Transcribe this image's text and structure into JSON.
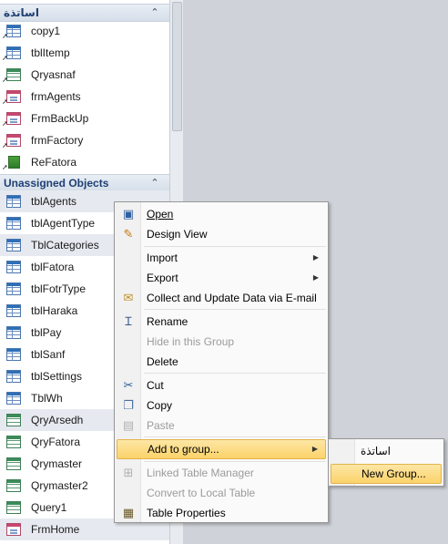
{
  "nav": {
    "groups": [
      {
        "title": "اساتذة",
        "items": [
          {
            "label": "copy1",
            "icon": "table-icon",
            "linked": true
          },
          {
            "label": "tblItemp",
            "icon": "table-icon",
            "linked": true
          },
          {
            "label": "Qryasnaf",
            "icon": "query-icon",
            "linked": true
          },
          {
            "label": "frmAgents",
            "icon": "form-icon",
            "linked": true
          },
          {
            "label": "FrmBackUp",
            "icon": "form-icon",
            "linked": true
          },
          {
            "label": "frmFactory",
            "icon": "form-icon",
            "linked": true
          },
          {
            "label": "ReFatora",
            "icon": "report-icon",
            "linked": true
          }
        ]
      },
      {
        "title": "Unassigned Objects",
        "items": [
          {
            "label": "tblAgents",
            "icon": "table-icon",
            "highlighted": true
          },
          {
            "label": "tblAgentType",
            "icon": "table-icon"
          },
          {
            "label": "TblCategories",
            "icon": "table-icon",
            "highlighted": true
          },
          {
            "label": "tblFatora",
            "icon": "table-icon"
          },
          {
            "label": "tblFotrType",
            "icon": "table-icon"
          },
          {
            "label": "tblHaraka",
            "icon": "table-icon"
          },
          {
            "label": "tblPay",
            "icon": "table-icon"
          },
          {
            "label": "tblSanf",
            "icon": "table-icon"
          },
          {
            "label": "tblSettings",
            "icon": "table-icon"
          },
          {
            "label": "TblWh",
            "icon": "table-icon"
          },
          {
            "label": "QryArsedh",
            "icon": "query-icon",
            "highlighted": true
          },
          {
            "label": "QryFatora",
            "icon": "query-icon"
          },
          {
            "label": "Qrymaster",
            "icon": "query-icon"
          },
          {
            "label": "Qrymaster2",
            "icon": "query-icon"
          },
          {
            "label": "Query1",
            "icon": "query-icon"
          },
          {
            "label": "FrmHome",
            "icon": "form-icon",
            "highlighted": true
          }
        ]
      }
    ]
  },
  "context_menu": {
    "items": [
      {
        "label": "Open",
        "icon": "open-icon"
      },
      {
        "label": "Design View",
        "icon": "design-view-icon"
      },
      {
        "label": "Import",
        "submenu": true
      },
      {
        "label": "Export",
        "submenu": true
      },
      {
        "label": "Collect and Update Data via E-mail",
        "icon": "collect-data-icon"
      },
      {
        "label": "Rename",
        "icon": "rename-icon"
      },
      {
        "label": "Hide in this Group",
        "disabled": true
      },
      {
        "label": "Delete"
      },
      {
        "label": "Cut",
        "icon": "scissors-icon"
      },
      {
        "label": "Copy",
        "icon": "copy-icon"
      },
      {
        "label": "Paste",
        "icon": "paste-icon",
        "disabled": true
      },
      {
        "label": "Add to group...",
        "submenu": true,
        "active": true
      },
      {
        "label": "Linked Table Manager",
        "icon": "linked-table-manager-icon",
        "disabled": true
      },
      {
        "label": "Convert to Local Table",
        "disabled": true
      },
      {
        "label": "Table Properties",
        "icon": "table-properties-icon"
      }
    ]
  },
  "submenu": {
    "items": [
      {
        "label": "اساتذة"
      },
      {
        "label": "New Group...",
        "active": true
      }
    ]
  },
  "colors": {
    "accent_highlight": "#fbd36a",
    "group_header_text": "#1f3f73",
    "workspace_bg": "#cfd3d9"
  }
}
